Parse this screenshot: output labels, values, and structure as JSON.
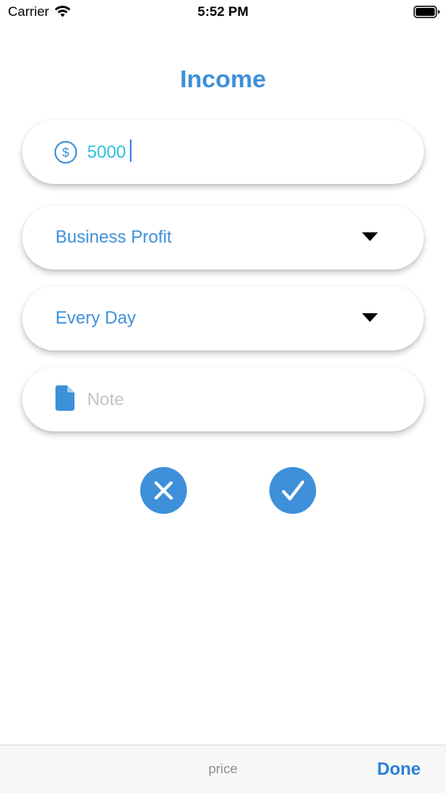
{
  "status_bar": {
    "carrier": "Carrier",
    "time": "5:52 PM",
    "icons": [
      "wifi-icon",
      "battery-icon"
    ]
  },
  "title": "Income",
  "amount": {
    "value": "5000",
    "icon": "dollar-circle-icon"
  },
  "category": {
    "selected": "Business Profit",
    "icon": "dropdown-arrow-icon"
  },
  "repeat": {
    "selected": "Every Day",
    "icon": "dropdown-arrow-icon"
  },
  "note": {
    "placeholder": "Note",
    "value": "",
    "icon": "document-icon"
  },
  "actions": {
    "cancel_icon": "close-icon",
    "confirm_icon": "checkmark-icon"
  },
  "keyboard_accessory": {
    "label": "price",
    "done_label": "Done"
  },
  "colors": {
    "accent": "#3d90d9",
    "amount_text": "#28c4dc",
    "placeholder": "#c4c4c8",
    "done": "#2a80d8"
  }
}
